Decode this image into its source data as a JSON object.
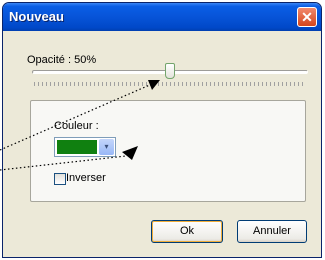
{
  "window": {
    "title": "Nouveau",
    "close_glyph": "✕"
  },
  "opacity": {
    "label": "Opacité : 50%",
    "value_percent": 50
  },
  "color": {
    "label": "Couleur :",
    "selected_color": "#108010",
    "dropdown_glyph": "▾"
  },
  "invert": {
    "label": "Inverser",
    "checked": false
  },
  "buttons": {
    "ok": "Ok",
    "cancel": "Annuler"
  },
  "colors": {
    "title_bar": "#0754d8",
    "close_button": "#d5451b",
    "dialog_bg": "#ece9d8"
  }
}
